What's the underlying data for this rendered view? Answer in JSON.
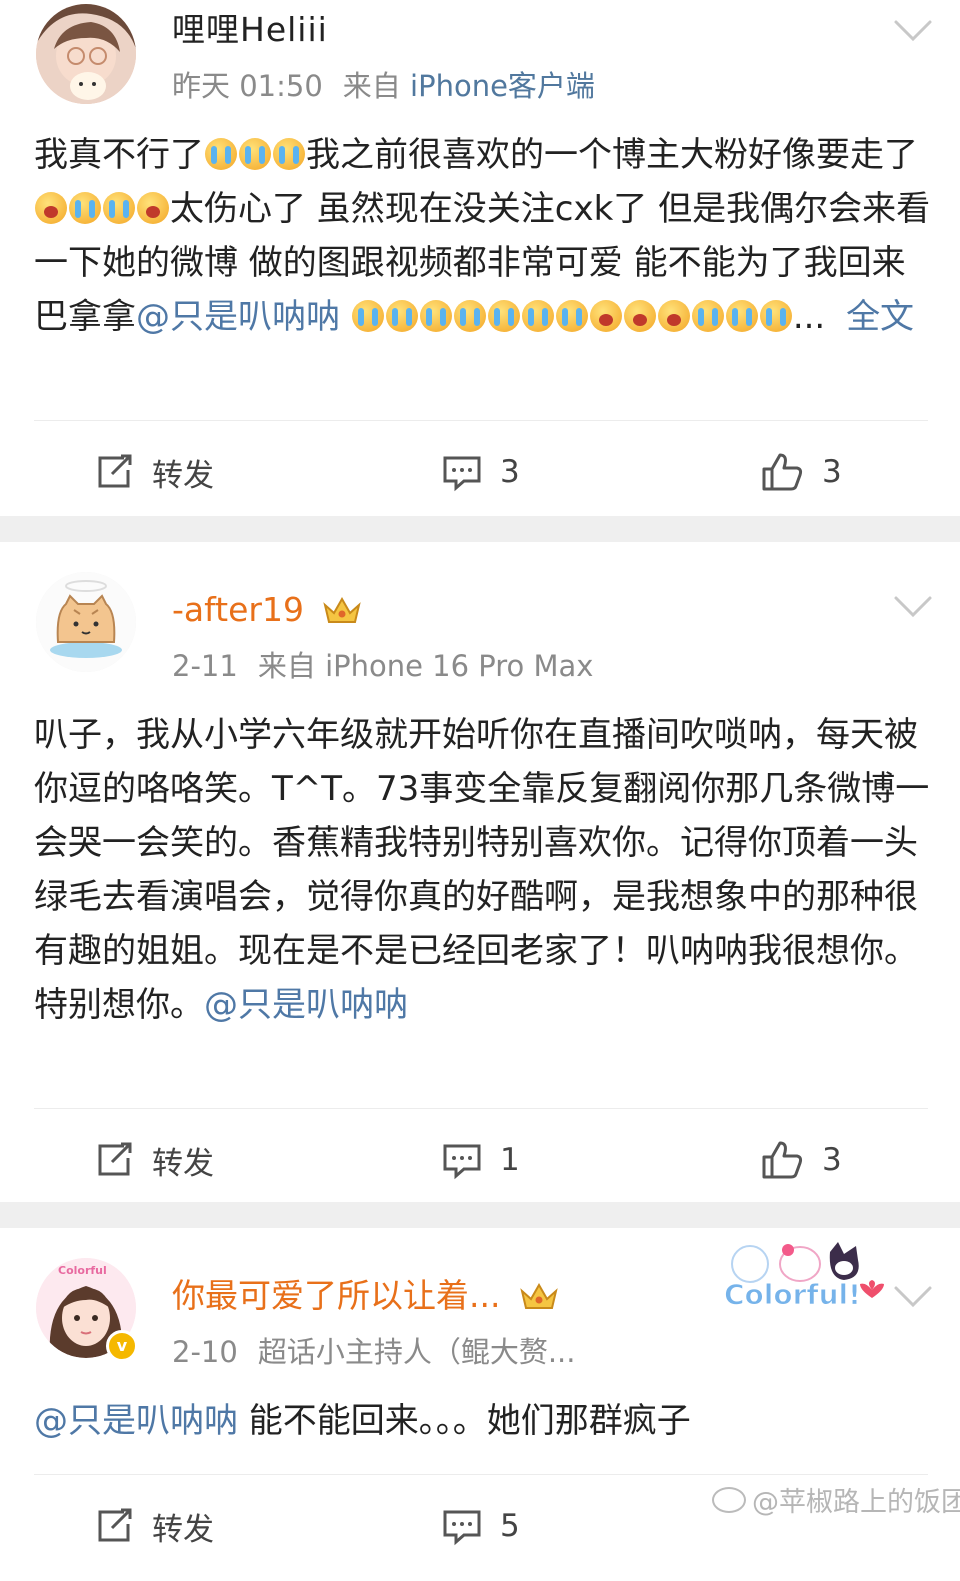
{
  "posts": [
    {
      "username": "哩哩Heliii",
      "time": "昨天 01:50",
      "source_prefix": "来自",
      "source": "iPhone客户端",
      "text_a": "我真不行了",
      "text_b": "我之前很喜欢的一个博主大粉好像要走了",
      "text_c": "太伤心了 虽然现在没关注cxk了 但是我偶尔会来看一下她的微博 做的图跟视频都非常可爱 能不能为了我回来巴拿拿",
      "mention": "@只是叭呐呐",
      "ellipsis": "...",
      "more": "全文",
      "emoji_group1": [
        "loudly-crying-face",
        "loudly-crying-face",
        "loudly-crying-face"
      ],
      "emoji_group2": [
        "sobbing-face",
        "loudly-crying-face",
        "loudly-crying-face",
        "sobbing-face"
      ],
      "emoji_group3": [
        "loudly-crying-face",
        "loudly-crying-face",
        "loudly-crying-face",
        "loudly-crying-face",
        "loudly-crying-face",
        "loudly-crying-face",
        "loudly-crying-face",
        "sobbing-face",
        "sobbing-face",
        "sobbing-face",
        "loudly-crying-face",
        "loudly-crying-face",
        "loudly-crying-face"
      ],
      "repost_label": "转发",
      "comment_count": "3",
      "like_count": "3"
    },
    {
      "username": "-after19",
      "time": "2-11",
      "source_prefix": "来自",
      "source": "iPhone 16 Pro Max",
      "text": "叭子，我从小学六年级就开始听你在直播间吹唢呐，每天被你逗的咯咯笑。T^T。73事变全靠反复翻阅你那几条微博一会哭一会笑的。香蕉精我特别特别喜欢你。记得你顶着一头绿毛去看演唱会，觉得你真的好酷啊，是我想象中的那种很有趣的姐姐。现在是不是已经回老家了！叭呐呐我很想你。特别想你。",
      "mention": "@只是叭呐呐",
      "repost_label": "转发",
      "comment_count": "1",
      "like_count": "3"
    },
    {
      "username": "你最可爱了所以让着...",
      "time": "2-10",
      "badge_text": "超话小主持人（鲲大赘...",
      "mention": "@只是叭呐呐",
      "text": " 能不能回来。。。她们那群疯子",
      "avatar_label": "Colorful",
      "decoration_label": "Colorful!",
      "repost_label": "转发",
      "comment_count": "5"
    }
  ],
  "watermark": "@苹椒路上的饭团",
  "colors": {
    "username_orange": "#e8701a",
    "link_blue": "#4f78a6",
    "meta_gray": "#8a8a8a",
    "separator": "#efefef"
  }
}
